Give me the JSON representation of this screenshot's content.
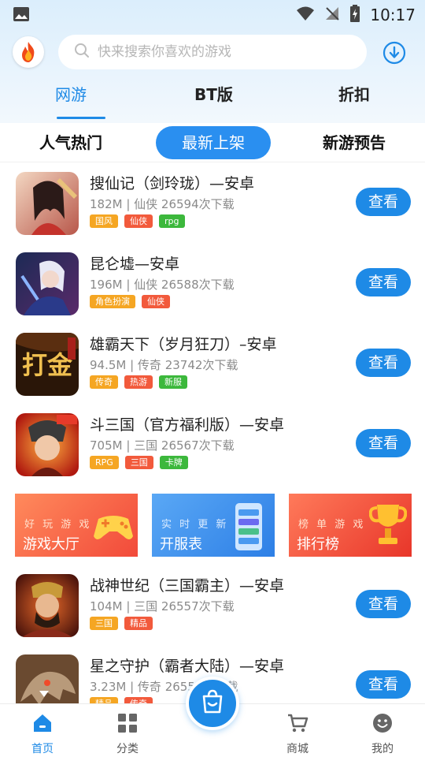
{
  "status_bar": {
    "time": "10:17"
  },
  "search": {
    "placeholder": "快来搜索你喜欢的游戏"
  },
  "top_tabs": [
    {
      "label": "网游",
      "active": true
    },
    {
      "label": "BT版",
      "active": false
    },
    {
      "label": "折扣",
      "active": false
    }
  ],
  "sub_tabs": [
    {
      "label": "人气热门",
      "active": false
    },
    {
      "label": "最新上架",
      "active": true
    },
    {
      "label": "新游预告",
      "active": false
    }
  ],
  "games": [
    {
      "title": "搜仙记（剑玲珑）—安卓",
      "meta": "182M | 仙侠  26594次下载",
      "tags": [
        {
          "label": "国风",
          "color": "#f5a623"
        },
        {
          "label": "仙侠",
          "color": "#f25a3c"
        },
        {
          "label": "rpg",
          "color": "#3cb83c"
        }
      ],
      "button": "查看"
    },
    {
      "title": "昆仑墟—安卓",
      "meta": "196M | 仙侠  26588次下载",
      "tags": [
        {
          "label": "角色扮演",
          "color": "#f5a623"
        },
        {
          "label": "仙侠",
          "color": "#f25a3c"
        }
      ],
      "button": "查看"
    },
    {
      "title": "雄霸天下（岁月狂刀）–安卓",
      "meta": "94.5M | 传奇  23742次下载",
      "tags": [
        {
          "label": "传奇",
          "color": "#f5a623"
        },
        {
          "label": "热游",
          "color": "#f25a3c"
        },
        {
          "label": "新服",
          "color": "#3cb83c"
        }
      ],
      "button": "查看"
    },
    {
      "title": "斗三国（官方福利版）—安卓",
      "meta": "705M | 三国  26567次下载",
      "tags": [
        {
          "label": "RPG",
          "color": "#f5a623"
        },
        {
          "label": "三国",
          "color": "#f25a3c"
        },
        {
          "label": "卡牌",
          "color": "#3cb83c"
        }
      ],
      "button": "查看"
    },
    {
      "title": "战神世纪（三国霸主）—安卓",
      "meta": "104M | 三国  26557次下载",
      "tags": [
        {
          "label": "三国",
          "color": "#f5a623"
        },
        {
          "label": "精品",
          "color": "#f25a3c"
        }
      ],
      "button": "查看"
    },
    {
      "title": "星之守护（霸者大陆）—安卓",
      "meta": "3.23M | 传奇  26550次下载",
      "tags": [
        {
          "label": "精品",
          "color": "#f5a623"
        },
        {
          "label": "传奇",
          "color": "#f25a3c"
        }
      ],
      "button": "查看"
    }
  ],
  "banners": [
    {
      "sub": "好 玩 游 戏",
      "main": "游戏大厅"
    },
    {
      "sub": "实 时 更 新",
      "main": "开服表"
    },
    {
      "sub": "榜 单 游 戏",
      "main": "排行榜"
    }
  ],
  "bottom_nav": [
    {
      "label": "首页",
      "icon": "home-icon",
      "active": true
    },
    {
      "label": "分类",
      "icon": "grid-icon",
      "active": false
    },
    {
      "label": "商城",
      "icon": "cart-icon",
      "active": false
    },
    {
      "label": "我的",
      "icon": "smile-icon",
      "active": false
    }
  ],
  "colors": {
    "accent": "#1e8ae6",
    "tag_orange": "#f5a623",
    "tag_red": "#f25a3c",
    "tag_green": "#3cb83c"
  }
}
